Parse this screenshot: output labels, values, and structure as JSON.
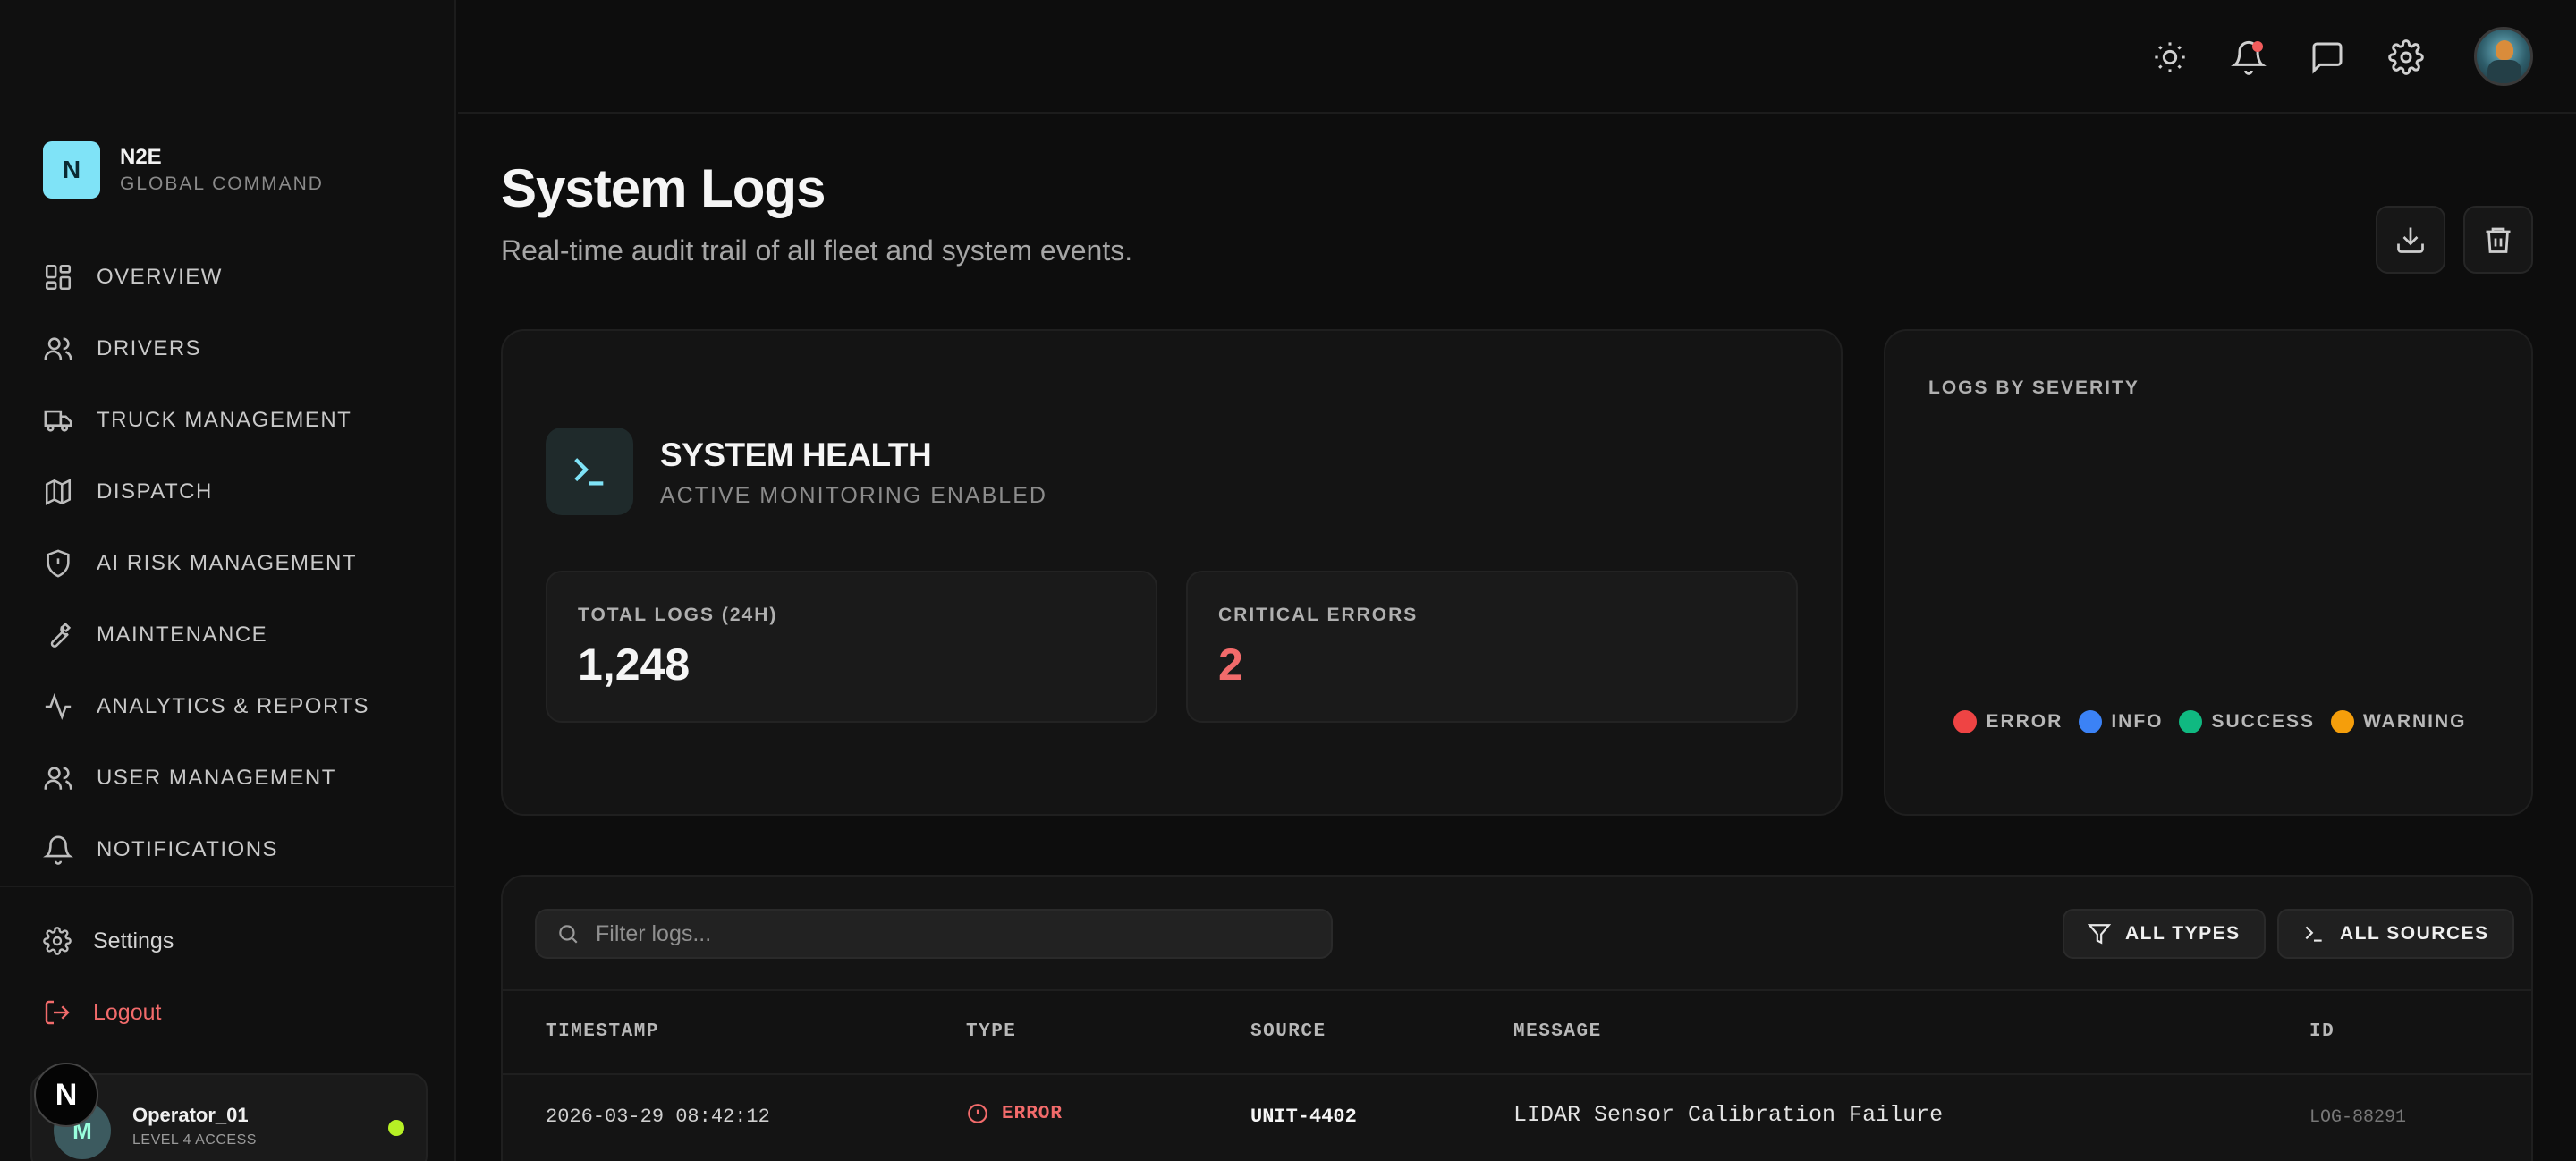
{
  "brand": {
    "logo_letter": "N",
    "name": "N2E",
    "subtitle": "GLOBAL COMMAND"
  },
  "sidebar": {
    "items": [
      {
        "label": "OVERVIEW",
        "icon": "grid-icon"
      },
      {
        "label": "DRIVERS",
        "icon": "users-icon"
      },
      {
        "label": "TRUCK MANAGEMENT",
        "icon": "truck-icon"
      },
      {
        "label": "DISPATCH",
        "icon": "map-icon"
      },
      {
        "label": "AI RISK MANAGEMENT",
        "icon": "shield-alert-icon"
      },
      {
        "label": "MAINTENANCE",
        "icon": "wrench-icon"
      },
      {
        "label": "ANALYTICS & REPORTS",
        "icon": "activity-icon"
      },
      {
        "label": "USER MANAGEMENT",
        "icon": "users-icon"
      },
      {
        "label": "NOTIFICATIONS",
        "icon": "bell-icon"
      }
    ],
    "settings_label": "Settings",
    "logout_label": "Logout"
  },
  "user": {
    "avatar_letter": "M",
    "badge_letter": "N",
    "name": "Operator_01",
    "role": "LEVEL 4 ACCESS",
    "status_color": "#b6f025"
  },
  "header": {
    "title": "System Logs",
    "subtitle": "Real-time audit trail of all fleet and system events."
  },
  "health": {
    "title": "SYSTEM HEALTH",
    "subtitle": "ACTIVE MONITORING ENABLED",
    "total_logs_label": "TOTAL LOGS (24H)",
    "total_logs_value": "1,248",
    "critical_errors_label": "CRITICAL ERRORS",
    "critical_errors_value": "2"
  },
  "severity": {
    "title": "LOGS BY SEVERITY",
    "legend": [
      {
        "label": "ERROR",
        "color": "#ef4444"
      },
      {
        "label": "INFO",
        "color": "#3b82f6"
      },
      {
        "label": "SUCCESS",
        "color": "#10b981"
      },
      {
        "label": "WARNING",
        "color": "#f59e0b"
      }
    ]
  },
  "logs": {
    "filter_placeholder": "Filter logs...",
    "type_filter_label": "ALL TYPES",
    "source_filter_label": "ALL SOURCES",
    "columns": [
      "TIMESTAMP",
      "TYPE",
      "SOURCE",
      "MESSAGE",
      "ID"
    ],
    "rows": [
      {
        "timestamp": "2026-03-29 08:42:12",
        "type": "ERROR",
        "source": "UNIT-4402",
        "message": "LIDAR Sensor Calibration Failure",
        "id": "LOG-88291"
      }
    ]
  },
  "colors": {
    "accent": "#7fe3f7",
    "error": "#f26b6b",
    "background": "#0d0d0d"
  }
}
